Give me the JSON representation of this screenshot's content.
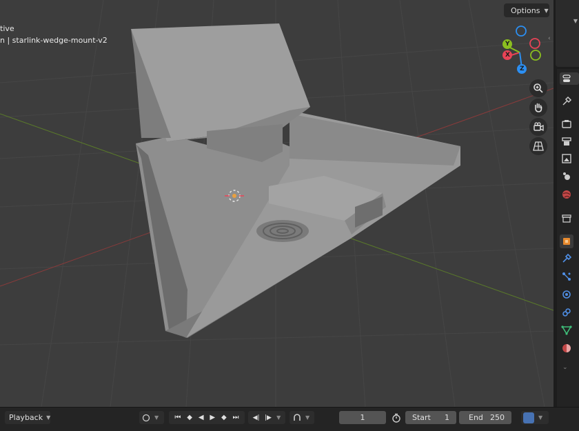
{
  "viewport": {
    "mode_text": "tive",
    "object_text": "n | starlink-wedge-mount-v2",
    "options_label": "Options",
    "gizmo": {
      "y": "Y",
      "x": "X",
      "z": "Z"
    },
    "nav_icons": [
      "zoom-icon",
      "hand-icon",
      "camera-icon",
      "grid-icon"
    ]
  },
  "properties": {
    "icons": [
      "tool",
      "render",
      "output",
      "view-layer",
      "scene",
      "world",
      "collection",
      "object",
      "modifier",
      "particles",
      "physics",
      "constraints",
      "data",
      "material"
    ]
  },
  "timeline": {
    "playback_label": "Playback",
    "current_frame": "1",
    "start_label": "Start",
    "start_value": "1",
    "end_label": "End",
    "end_value": "250"
  },
  "colors": {
    "accent": "#4772b3",
    "x_axis": "#e84356",
    "y_axis": "#8bbf1f",
    "z_axis": "#2c8ff2"
  }
}
